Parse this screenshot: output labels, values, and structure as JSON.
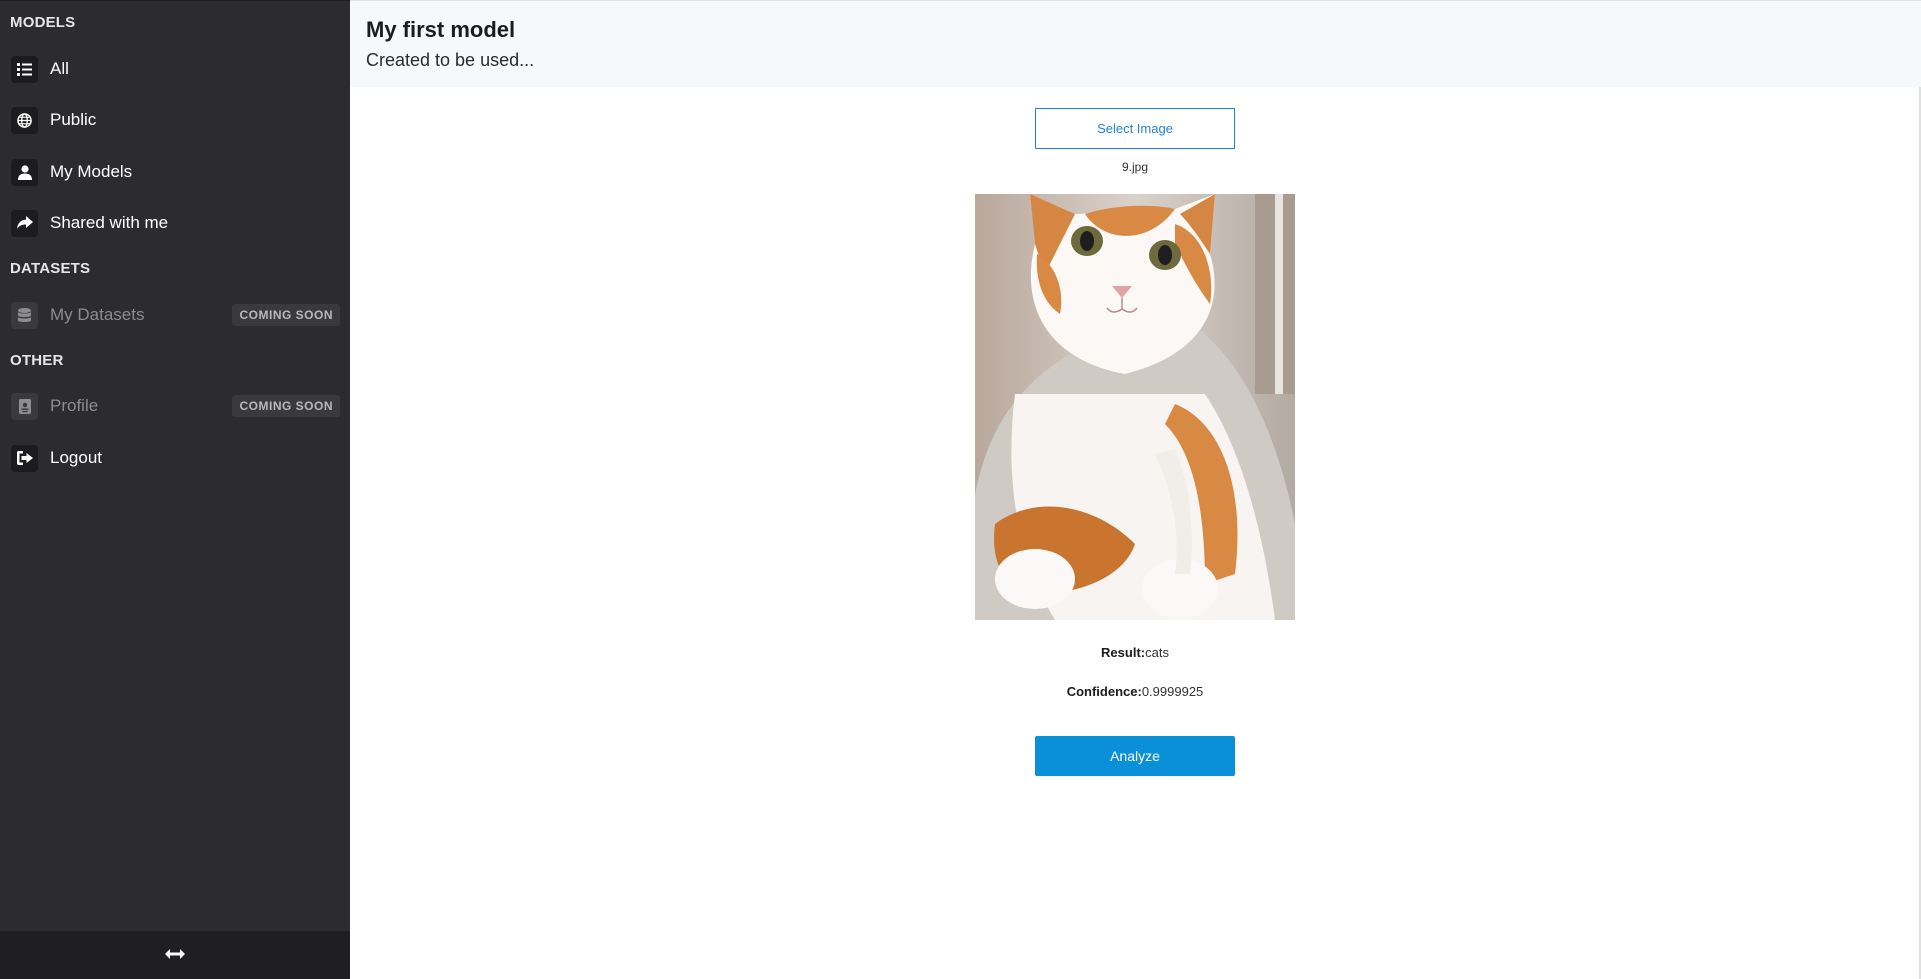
{
  "sidebar": {
    "sections": {
      "models": "MODELS",
      "datasets": "DATASETS",
      "other": "OTHER"
    },
    "items": {
      "all": "All",
      "public": "Public",
      "my_models": "My Models",
      "shared": "Shared with me",
      "my_datasets": "My Datasets",
      "profile": "Profile",
      "logout": "Logout"
    },
    "coming_soon": "COMING SOON",
    "icons": {
      "all": "list-icon",
      "public": "globe-icon",
      "my_models": "user-icon",
      "shared": "share-arrow-icon",
      "my_datasets": "database-icon",
      "profile": "id-card-icon",
      "logout": "sign-out-icon",
      "footer": "horizontal-resize-icon"
    }
  },
  "header": {
    "title": "My first model",
    "subtitle": "Created to be used..."
  },
  "main": {
    "select_button": "Select Image",
    "filename": "9.jpg",
    "result_label": "Result:",
    "result_value": "cats",
    "confidence_label": "Confidence:",
    "confidence_value": "0.9999925",
    "analyze_button": "Analyze"
  },
  "colors": {
    "sidebar_bg": "#2c2c2f",
    "primary": "#2185d0",
    "analyze_bg": "#0a90d8",
    "header_bg": "#f7f8fa"
  }
}
